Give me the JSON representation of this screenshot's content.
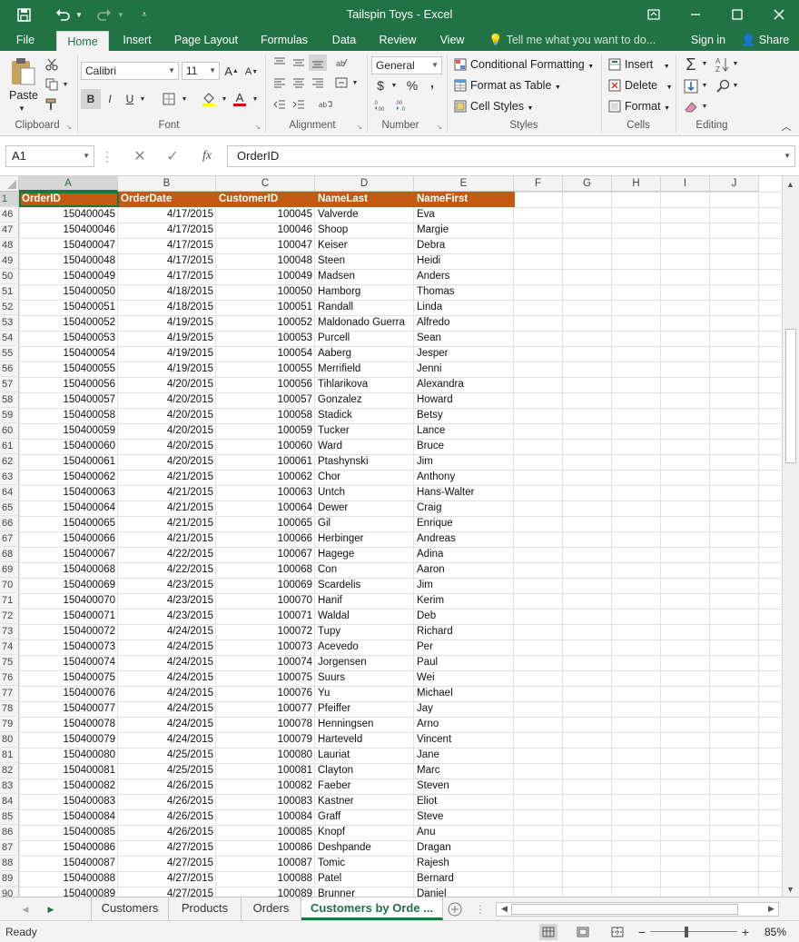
{
  "window": {
    "title": "Tailspin Toys  -  Excel"
  },
  "ribbon_tabs": [
    "File",
    "Home",
    "Insert",
    "Page Layout",
    "Formulas",
    "Data",
    "Review",
    "View"
  ],
  "tell_me": "Tell me what you want to do...",
  "sign_in": "Sign in",
  "share": "Share",
  "ribbon": {
    "clipboard": {
      "paste": "Paste",
      "label": "Clipboard"
    },
    "font": {
      "name": "Calibri",
      "size": "11",
      "bold": "B",
      "italic": "I",
      "underline": "U",
      "label": "Font"
    },
    "alignment": {
      "label": "Alignment"
    },
    "number": {
      "format": "General",
      "currency": "$",
      "percent": "%",
      "comma": ",",
      "label": "Number"
    },
    "styles": {
      "conditional": "Conditional Formatting",
      "format_table": "Format as Table",
      "cell_styles": "Cell Styles",
      "label": "Styles"
    },
    "cells": {
      "insert": "Insert",
      "delete": "Delete",
      "format": "Format",
      "label": "Cells"
    },
    "editing": {
      "label": "Editing"
    }
  },
  "formula_bar": {
    "name_box": "A1",
    "fx": "fx",
    "value": "OrderID"
  },
  "columns": [
    "A",
    "B",
    "C",
    "D",
    "E",
    "F",
    "G",
    "H",
    "I",
    "J"
  ],
  "header_row": {
    "num": "1",
    "cells": [
      "OrderID",
      "OrderDate",
      "CustomerID",
      "NameLast",
      "NameFirst"
    ]
  },
  "rows": [
    {
      "num": "46",
      "cells": [
        "150400045",
        "4/17/2015",
        "100045",
        "Valverde",
        "Eva"
      ]
    },
    {
      "num": "47",
      "cells": [
        "150400046",
        "4/17/2015",
        "100046",
        "Shoop",
        "Margie"
      ]
    },
    {
      "num": "48",
      "cells": [
        "150400047",
        "4/17/2015",
        "100047",
        "Keiser",
        "Debra"
      ]
    },
    {
      "num": "49",
      "cells": [
        "150400048",
        "4/17/2015",
        "100048",
        "Steen",
        "Heidi"
      ]
    },
    {
      "num": "50",
      "cells": [
        "150400049",
        "4/17/2015",
        "100049",
        "Madsen",
        "Anders"
      ]
    },
    {
      "num": "51",
      "cells": [
        "150400050",
        "4/18/2015",
        "100050",
        "Hamborg",
        "Thomas"
      ]
    },
    {
      "num": "52",
      "cells": [
        "150400051",
        "4/18/2015",
        "100051",
        "Randall",
        "Linda"
      ]
    },
    {
      "num": "53",
      "cells": [
        "150400052",
        "4/19/2015",
        "100052",
        "Maldonado Guerra",
        "Alfredo"
      ]
    },
    {
      "num": "54",
      "cells": [
        "150400053",
        "4/19/2015",
        "100053",
        "Purcell",
        "Sean"
      ]
    },
    {
      "num": "55",
      "cells": [
        "150400054",
        "4/19/2015",
        "100054",
        "Aaberg",
        "Jesper"
      ]
    },
    {
      "num": "56",
      "cells": [
        "150400055",
        "4/19/2015",
        "100055",
        "Merrifield",
        "Jenni"
      ]
    },
    {
      "num": "57",
      "cells": [
        "150400056",
        "4/20/2015",
        "100056",
        "Tihlarikova",
        "Alexandra"
      ]
    },
    {
      "num": "58",
      "cells": [
        "150400057",
        "4/20/2015",
        "100057",
        "Gonzalez",
        "Howard"
      ]
    },
    {
      "num": "59",
      "cells": [
        "150400058",
        "4/20/2015",
        "100058",
        "Stadick",
        "Betsy"
      ]
    },
    {
      "num": "60",
      "cells": [
        "150400059",
        "4/20/2015",
        "100059",
        "Tucker",
        "Lance"
      ]
    },
    {
      "num": "61",
      "cells": [
        "150400060",
        "4/20/2015",
        "100060",
        "Ward",
        "Bruce"
      ]
    },
    {
      "num": "62",
      "cells": [
        "150400061",
        "4/20/2015",
        "100061",
        "Ptashynski",
        "Jim"
      ]
    },
    {
      "num": "63",
      "cells": [
        "150400062",
        "4/21/2015",
        "100062",
        "Chor",
        "Anthony"
      ]
    },
    {
      "num": "64",
      "cells": [
        "150400063",
        "4/21/2015",
        "100063",
        "Untch",
        "Hans-Walter"
      ]
    },
    {
      "num": "65",
      "cells": [
        "150400064",
        "4/21/2015",
        "100064",
        "Dewer",
        "Craig"
      ]
    },
    {
      "num": "66",
      "cells": [
        "150400065",
        "4/21/2015",
        "100065",
        "Gil",
        "Enrique"
      ]
    },
    {
      "num": "67",
      "cells": [
        "150400066",
        "4/21/2015",
        "100066",
        "Herbinger",
        "Andreas"
      ]
    },
    {
      "num": "68",
      "cells": [
        "150400067",
        "4/22/2015",
        "100067",
        "Hagege",
        "Adina"
      ]
    },
    {
      "num": "69",
      "cells": [
        "150400068",
        "4/22/2015",
        "100068",
        "Con",
        "Aaron"
      ]
    },
    {
      "num": "70",
      "cells": [
        "150400069",
        "4/23/2015",
        "100069",
        "Scardelis",
        "Jim"
      ]
    },
    {
      "num": "71",
      "cells": [
        "150400070",
        "4/23/2015",
        "100070",
        "Hanif",
        "Kerim"
      ]
    },
    {
      "num": "72",
      "cells": [
        "150400071",
        "4/23/2015",
        "100071",
        "Waldal",
        "Deb"
      ]
    },
    {
      "num": "73",
      "cells": [
        "150400072",
        "4/24/2015",
        "100072",
        "Tupy",
        "Richard"
      ]
    },
    {
      "num": "74",
      "cells": [
        "150400073",
        "4/24/2015",
        "100073",
        "Acevedo",
        "Per"
      ]
    },
    {
      "num": "75",
      "cells": [
        "150400074",
        "4/24/2015",
        "100074",
        "Jorgensen",
        "Paul"
      ]
    },
    {
      "num": "76",
      "cells": [
        "150400075",
        "4/24/2015",
        "100075",
        "Suurs",
        "Wei"
      ]
    },
    {
      "num": "77",
      "cells": [
        "150400076",
        "4/24/2015",
        "100076",
        "Yu",
        "Michael"
      ]
    },
    {
      "num": "78",
      "cells": [
        "150400077",
        "4/24/2015",
        "100077",
        "Pfeiffer",
        "Jay"
      ]
    },
    {
      "num": "79",
      "cells": [
        "150400078",
        "4/24/2015",
        "100078",
        "Henningsen",
        "Arno"
      ]
    },
    {
      "num": "80",
      "cells": [
        "150400079",
        "4/24/2015",
        "100079",
        "Harteveld",
        "Vincent"
      ]
    },
    {
      "num": "81",
      "cells": [
        "150400080",
        "4/25/2015",
        "100080",
        "Lauriat",
        "Jane"
      ]
    },
    {
      "num": "82",
      "cells": [
        "150400081",
        "4/25/2015",
        "100081",
        "Clayton",
        "Marc"
      ]
    },
    {
      "num": "83",
      "cells": [
        "150400082",
        "4/26/2015",
        "100082",
        "Faeber",
        "Steven"
      ]
    },
    {
      "num": "84",
      "cells": [
        "150400083",
        "4/26/2015",
        "100083",
        "Kastner",
        "Eliot"
      ]
    },
    {
      "num": "85",
      "cells": [
        "150400084",
        "4/26/2015",
        "100084",
        "Graff",
        "Steve"
      ]
    },
    {
      "num": "86",
      "cells": [
        "150400085",
        "4/26/2015",
        "100085",
        "Knopf",
        "Anu"
      ]
    },
    {
      "num": "87",
      "cells": [
        "150400086",
        "4/27/2015",
        "100086",
        "Deshpande",
        "Dragan"
      ]
    },
    {
      "num": "88",
      "cells": [
        "150400087",
        "4/27/2015",
        "100087",
        "Tomic",
        "Rajesh"
      ]
    },
    {
      "num": "89",
      "cells": [
        "150400088",
        "4/27/2015",
        "100088",
        "Patel",
        "Bernard"
      ]
    },
    {
      "num": "90",
      "cells": [
        "150400089",
        "4/27/2015",
        "100089",
        "Brunner",
        "Daniel"
      ]
    }
  ],
  "sheet_tabs": [
    "Customers",
    "Products",
    "Orders",
    "Customers by Orde ..."
  ],
  "active_sheet": 3,
  "status": {
    "text": "Ready",
    "zoom": "85%"
  },
  "colors": {
    "accent": "#217346",
    "header_fill": "#c65911"
  },
  "icons": {
    "save": "save-icon",
    "undo": "undo-icon",
    "redo": "redo-icon",
    "search": "search-icon"
  }
}
